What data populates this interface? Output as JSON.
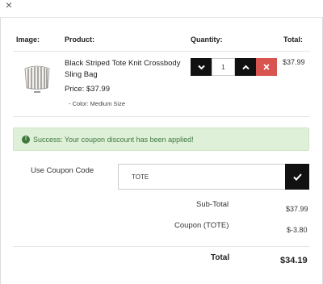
{
  "window": {
    "close_glyph": "×"
  },
  "table": {
    "headers": {
      "image": "Image:",
      "product": "Product:",
      "quantity": "Quantity:",
      "total": "Total:"
    }
  },
  "item": {
    "name": "Black Striped Tote Knit Crossbody Sling Bag",
    "price": "Price: $37.99",
    "option": "- Color: Medium Size",
    "quantity": "1",
    "line_total": "$37.99",
    "icons": {
      "decrease": "chevron-down-icon",
      "increase": "chevron-up-icon",
      "remove": "close-icon"
    }
  },
  "alert": {
    "message": "Success: Your coupon discount has been applied!",
    "color": "#3c763d"
  },
  "coupon": {
    "label": "Use Coupon Code",
    "value": "TOTE",
    "submit_icon": "checkmark-icon"
  },
  "summary": {
    "subtotal_label": "Sub-Total",
    "subtotal_value": "$37.99",
    "coupon_label": "Coupon (TOTE)",
    "coupon_value": "$-3.80",
    "total_label": "Total",
    "total_value": "$34.19"
  },
  "colors": {
    "button_dark": "#111111",
    "button_danger": "#d9534f",
    "alert_bg": "#dff0d8"
  }
}
